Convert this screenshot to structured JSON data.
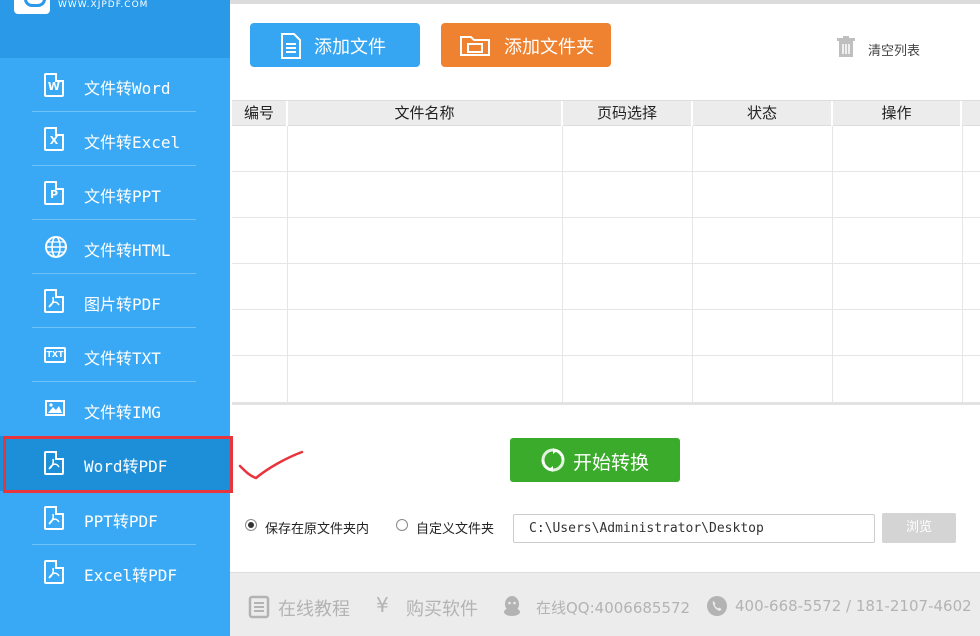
{
  "logo": {
    "url_text": "WWW.XJPDF.COM"
  },
  "sidebar": {
    "items": [
      {
        "label": "文件转Word",
        "icon": "word-doc-icon",
        "glyph": "W"
      },
      {
        "label": "文件转Excel",
        "icon": "excel-doc-icon",
        "glyph": "X"
      },
      {
        "label": "文件转PPT",
        "icon": "ppt-doc-icon",
        "glyph": "P"
      },
      {
        "label": "文件转HTML",
        "icon": "globe-icon",
        "glyph": ""
      },
      {
        "label": "图片转PDF",
        "icon": "pdf-doc-icon",
        "glyph": ""
      },
      {
        "label": "文件转TXT",
        "icon": "txt-icon",
        "glyph": "TXT"
      },
      {
        "label": "文件转IMG",
        "icon": "image-icon",
        "glyph": ""
      },
      {
        "label": "Word转PDF",
        "icon": "pdf-doc-icon",
        "glyph": ""
      },
      {
        "label": "PPT转PDF",
        "icon": "pdf-doc-icon",
        "glyph": ""
      },
      {
        "label": "Excel转PDF",
        "icon": "pdf-doc-icon",
        "glyph": ""
      }
    ],
    "active_index": 7
  },
  "toolbar": {
    "add_file": "添加文件",
    "add_folder": "添加文件夹",
    "clear_list": "清空列表"
  },
  "table": {
    "columns": [
      "编号",
      "文件名称",
      "页码选择",
      "状态",
      "操作"
    ],
    "rows": []
  },
  "start_button": "开始转换",
  "save_options": {
    "original_folder": "保存在原文件夹内",
    "custom_folder": "自定义文件夹",
    "selected": "original_folder",
    "path": "C:\\Users\\Administrator\\Desktop",
    "browse": "浏览"
  },
  "footer": {
    "tutorial": "在线教程",
    "buy": "购买软件",
    "qq": "在线QQ:4006685572",
    "phone": "400-668-5572 / 181-2107-4602"
  },
  "colors": {
    "sidebar_bg": "#3aa9f5",
    "sidebar_active": "#1d8fd8",
    "add_file": "#37a6f2",
    "add_folder": "#ee8230",
    "start": "#3aab2a",
    "annotation": "#e8353d"
  }
}
